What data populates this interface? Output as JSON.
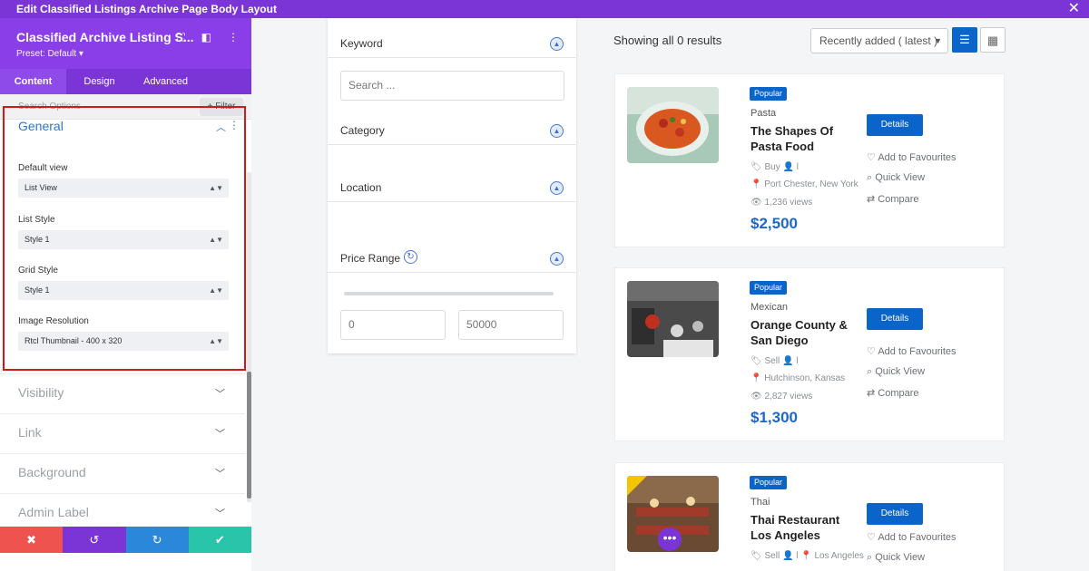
{
  "app": {
    "title": "Edit Classified Listings Archive Page Body Layout"
  },
  "panel": {
    "module_title": "Classified Archive Listing S...",
    "preset": "Preset: Default",
    "tabs": [
      "Content",
      "Design",
      "Advanced"
    ],
    "search_placeholder": "Search Options",
    "filter_label": "Filter",
    "general": {
      "title": "General",
      "fields": [
        {
          "label": "Default view",
          "value": "List View"
        },
        {
          "label": "List Style",
          "value": "Style 1"
        },
        {
          "label": "Grid Style",
          "value": "Style 1"
        },
        {
          "label": "Image Resolution",
          "value": "Rtcl Thumbnail - 400 x 320"
        }
      ]
    },
    "sections": [
      "Visibility",
      "Link",
      "Background",
      "Admin Label"
    ]
  },
  "filters": {
    "keyword": "Keyword",
    "search_placeholder": "Search ...",
    "category": "Category",
    "location": "Location",
    "price_range": "Price Range",
    "min": "0",
    "max": "50000"
  },
  "results": {
    "heading": "Showing all 0 results",
    "sort": "Recently added ( latest )"
  },
  "listings": [
    {
      "badge": "Popular",
      "category": "Pasta",
      "title": "The Shapes Of Pasta Food",
      "type": "Buy",
      "user": "l",
      "location": "Port Chester, New York",
      "views": "1,236 views",
      "price": "$2,500"
    },
    {
      "badge": "Popular",
      "category": "Mexican",
      "title": "Orange County & San Diego",
      "type": "Sell",
      "user": "l",
      "location": "Hutchinson, Kansas",
      "views": "2,827 views",
      "price": "$1,300"
    },
    {
      "badge": "Popular",
      "category": "Thai",
      "title": "Thai Restaurant Los Angeles",
      "type": "Sell",
      "user": "l",
      "location": "Los Angeles",
      "views": "",
      "price": ""
    }
  ],
  "actions": {
    "details": "Details",
    "favourite": "Add to Favourites",
    "quick_view": "Quick View",
    "compare": "Compare"
  },
  "colors": {
    "primary_purple": "#7b35d6",
    "accent_blue": "#0b64c9",
    "highlight_red": "#d01a1a"
  }
}
